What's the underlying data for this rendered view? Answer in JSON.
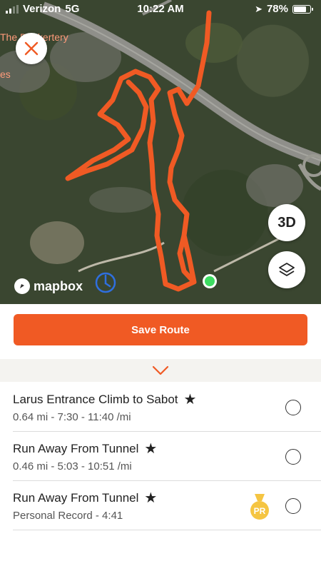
{
  "status_bar": {
    "carrier": "Verizon",
    "network": "5G",
    "time": "10:22 AM",
    "battery": "78%",
    "battery_level": 0.78
  },
  "map": {
    "labels": [
      "The Bookertery",
      "es"
    ],
    "attribution": "mapbox",
    "btn_3d": "3D",
    "icons": [
      "close-icon",
      "layers-icon",
      "compass-icon",
      "location-dot-icon"
    ],
    "route_color": "#f05a24"
  },
  "save_route_label": "Save Route",
  "colors": {
    "accent": "#f05a24",
    "badge": "#f5c542"
  },
  "segments": [
    {
      "title": "Larus Entrance Climb to Sabot",
      "starred": "★",
      "subtitle": "0.64 mi - 7:30 - 11:40 /mi",
      "badge": ""
    },
    {
      "title": "Run Away From Tunnel",
      "starred": "★",
      "subtitle": "0.46 mi - 5:03 - 10:51 /mi",
      "badge": ""
    },
    {
      "title": "Run Away From Tunnel",
      "starred": "★",
      "subtitle": "Personal Record - 4:41",
      "badge": "PR"
    }
  ]
}
